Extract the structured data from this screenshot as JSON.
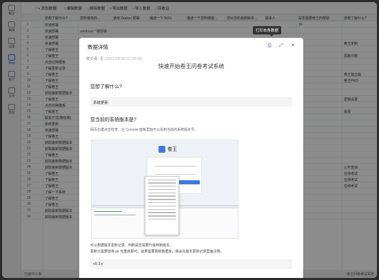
{
  "sidebar": {
    "items": [
      {
        "label": "概览",
        "icon": "home-icon"
      },
      {
        "label": "编辑",
        "icon": "edit-icon"
      },
      {
        "label": "设置",
        "icon": "gear-icon"
      },
      {
        "label": "数据",
        "icon": "table-icon",
        "active": true
      },
      {
        "label": "统计",
        "icon": "chart-icon"
      },
      {
        "label": "分享",
        "icon": "share-icon"
      },
      {
        "label": "其他",
        "icon": "more-icon"
      }
    ]
  },
  "toolbar": {
    "buttons": [
      "+ 添加数据",
      "编辑数据",
      "删除数据",
      "导出数据",
      "导入数据",
      "回收站"
    ]
  },
  "grid": {
    "headers": [
      "",
      "您想了解什么?",
      "您所使用的...",
      "使用 Docker 部署",
      "描述一下 BUG",
      "描述一下您所期望...",
      "您对您的系统版本...",
      "联系人",
      "是否需要卷王的帮助",
      "您想了解什么?"
    ],
    "rows": [
      {
        "num": "1",
        "c1": "快速部署",
        "c9": "",
        "c10": ""
      },
      {
        "num": "2",
        "c1": "快速部署",
        "c2": "windows一键部署",
        "c9": "",
        "c10": ""
      },
      {
        "num": "3",
        "c1": "快速部署",
        "c2": "",
        "c9": "",
        "c10": ""
      },
      {
        "num": "4",
        "c1": "快速部署",
        "c9": "",
        "c10": "卷王定制"
      },
      {
        "num": "5",
        "c1": "了解卷王",
        "c9": "",
        "c10": ""
      },
      {
        "num": "6",
        "c1": "了解卷王",
        "c9": "",
        "c10": "源数问卷"
      },
      {
        "num": "7",
        "c1": "点击切换模板",
        "c9": "",
        "c10": ""
      },
      {
        "num": "8",
        "c1": "了解更新记录",
        "c9": "",
        "c10": ""
      },
      {
        "num": "9",
        "c1": "了解卷王",
        "c9": "",
        "c10": "卷王独立版"
      },
      {
        "num": "10",
        "c1": "了解卷王",
        "c9": "",
        "c10": "卷王PRO"
      },
      {
        "num": "11",
        "c1": "了解卷王",
        "c9": "",
        "c10": ""
      },
      {
        "num": "12",
        "c1": "获取最新数据版本",
        "c9": "",
        "c10": ""
      },
      {
        "num": "13",
        "c1": "了解卷王",
        "c9": "",
        "c10": "逻辑设置"
      },
      {
        "num": "14",
        "c1": "点击切换模板",
        "c9": "",
        "c10": ""
      },
      {
        "num": "15",
        "c1": "了解卷王",
        "c9": "",
        "c10": "投票"
      },
      {
        "num": "16",
        "c1": "联系方式(微信等)",
        "c9": "",
        "c10": ""
      },
      {
        "num": "17",
        "c1": "系统更新",
        "c9": "",
        "c10": ""
      },
      {
        "num": "18",
        "c1": "快速部署",
        "c9": "",
        "c10": ""
      },
      {
        "num": "19",
        "c1": "了解卷王",
        "c9": "",
        "c10": ""
      },
      {
        "num": "20",
        "c1": "获取最新数据版本",
        "c9": "",
        "c10": ""
      },
      {
        "num": "21",
        "c1": "获取最新数据版本",
        "c9": "",
        "c10": ""
      },
      {
        "num": "22",
        "c1": "了解卷王",
        "c9": "",
        "c10": ""
      },
      {
        "num": "23",
        "c1": "获取最新数据版本",
        "c9": "",
        "c10": ""
      },
      {
        "num": "24",
        "c1": "获取最新数据版本",
        "c9": "",
        "c10": "公开查询"
      },
      {
        "num": "25",
        "c1": "了解卷王",
        "c9": "",
        "c10": "在线考试"
      },
      {
        "num": "26",
        "c1": "了解卷王",
        "c9": "",
        "c10": "在线考试"
      },
      {
        "num": "27",
        "c1": "了解卷王",
        "c9": "",
        "c10": "在线考试"
      },
      {
        "num": "28",
        "c1": "了解一下系统",
        "c9": "",
        "c10": ""
      },
      {
        "num": "29",
        "c1": "了解卷王",
        "c9": "",
        "c10": ""
      },
      {
        "num": "30",
        "c1": "了解卷王",
        "c9": "",
        "c10": ""
      },
      {
        "num": "31",
        "c1": "获取最新数据版本",
        "c9": "",
        "c10": ""
      },
      {
        "num": "32",
        "c1": "获取最新数据版本",
        "c9": "",
        "c10": ""
      }
    ],
    "extra": {
      "r1c9": "10"
    }
  },
  "status": {
    "left": "已选中 0 条",
    "right": "卷王问卷考试系统"
  },
  "modal": {
    "title": "数据详情",
    "tooltip": "打印本条数据",
    "submitter_label": "提交者:",
    "submitter_value": "无",
    "submit_time": "(2022-09-30 01:23:06)",
    "form_title": "快速开始卷王问卷考试系统",
    "q1": "您想了解什么?",
    "a1": "系统更新",
    "q2": "您当前的系统版本是?",
    "q2_desc": "网页右键点击检查，在 Console 面板里面可以看到当前的系统版本号。",
    "screenshot_brand": "卷王",
    "note1": "可以根据版本更新记录，判断是否需要升级到新版本。",
    "note2": "更新只需要替换 jar 包重启即可，如果需要更新数据库，我会在版本更新记录里面注明。",
    "a2": "v0.3.x"
  }
}
